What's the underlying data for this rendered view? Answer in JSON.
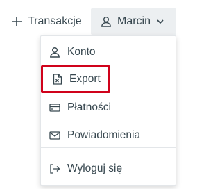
{
  "header": {
    "transactions_label": "Transakcje",
    "user_name": "Marcin"
  },
  "menu": {
    "items": [
      {
        "label": "Konto",
        "icon": "user-icon"
      },
      {
        "label": "Export",
        "icon": "excel-file-icon"
      },
      {
        "label": "Płatności",
        "icon": "credit-card-icon"
      },
      {
        "label": "Powiadomienia",
        "icon": "envelope-icon"
      },
      {
        "label": "Wyloguj się",
        "icon": "logout-icon"
      }
    ]
  },
  "colors": {
    "highlight_border": "#d0021b",
    "user_button_bg": "#eceff1",
    "text": "#37474f"
  }
}
